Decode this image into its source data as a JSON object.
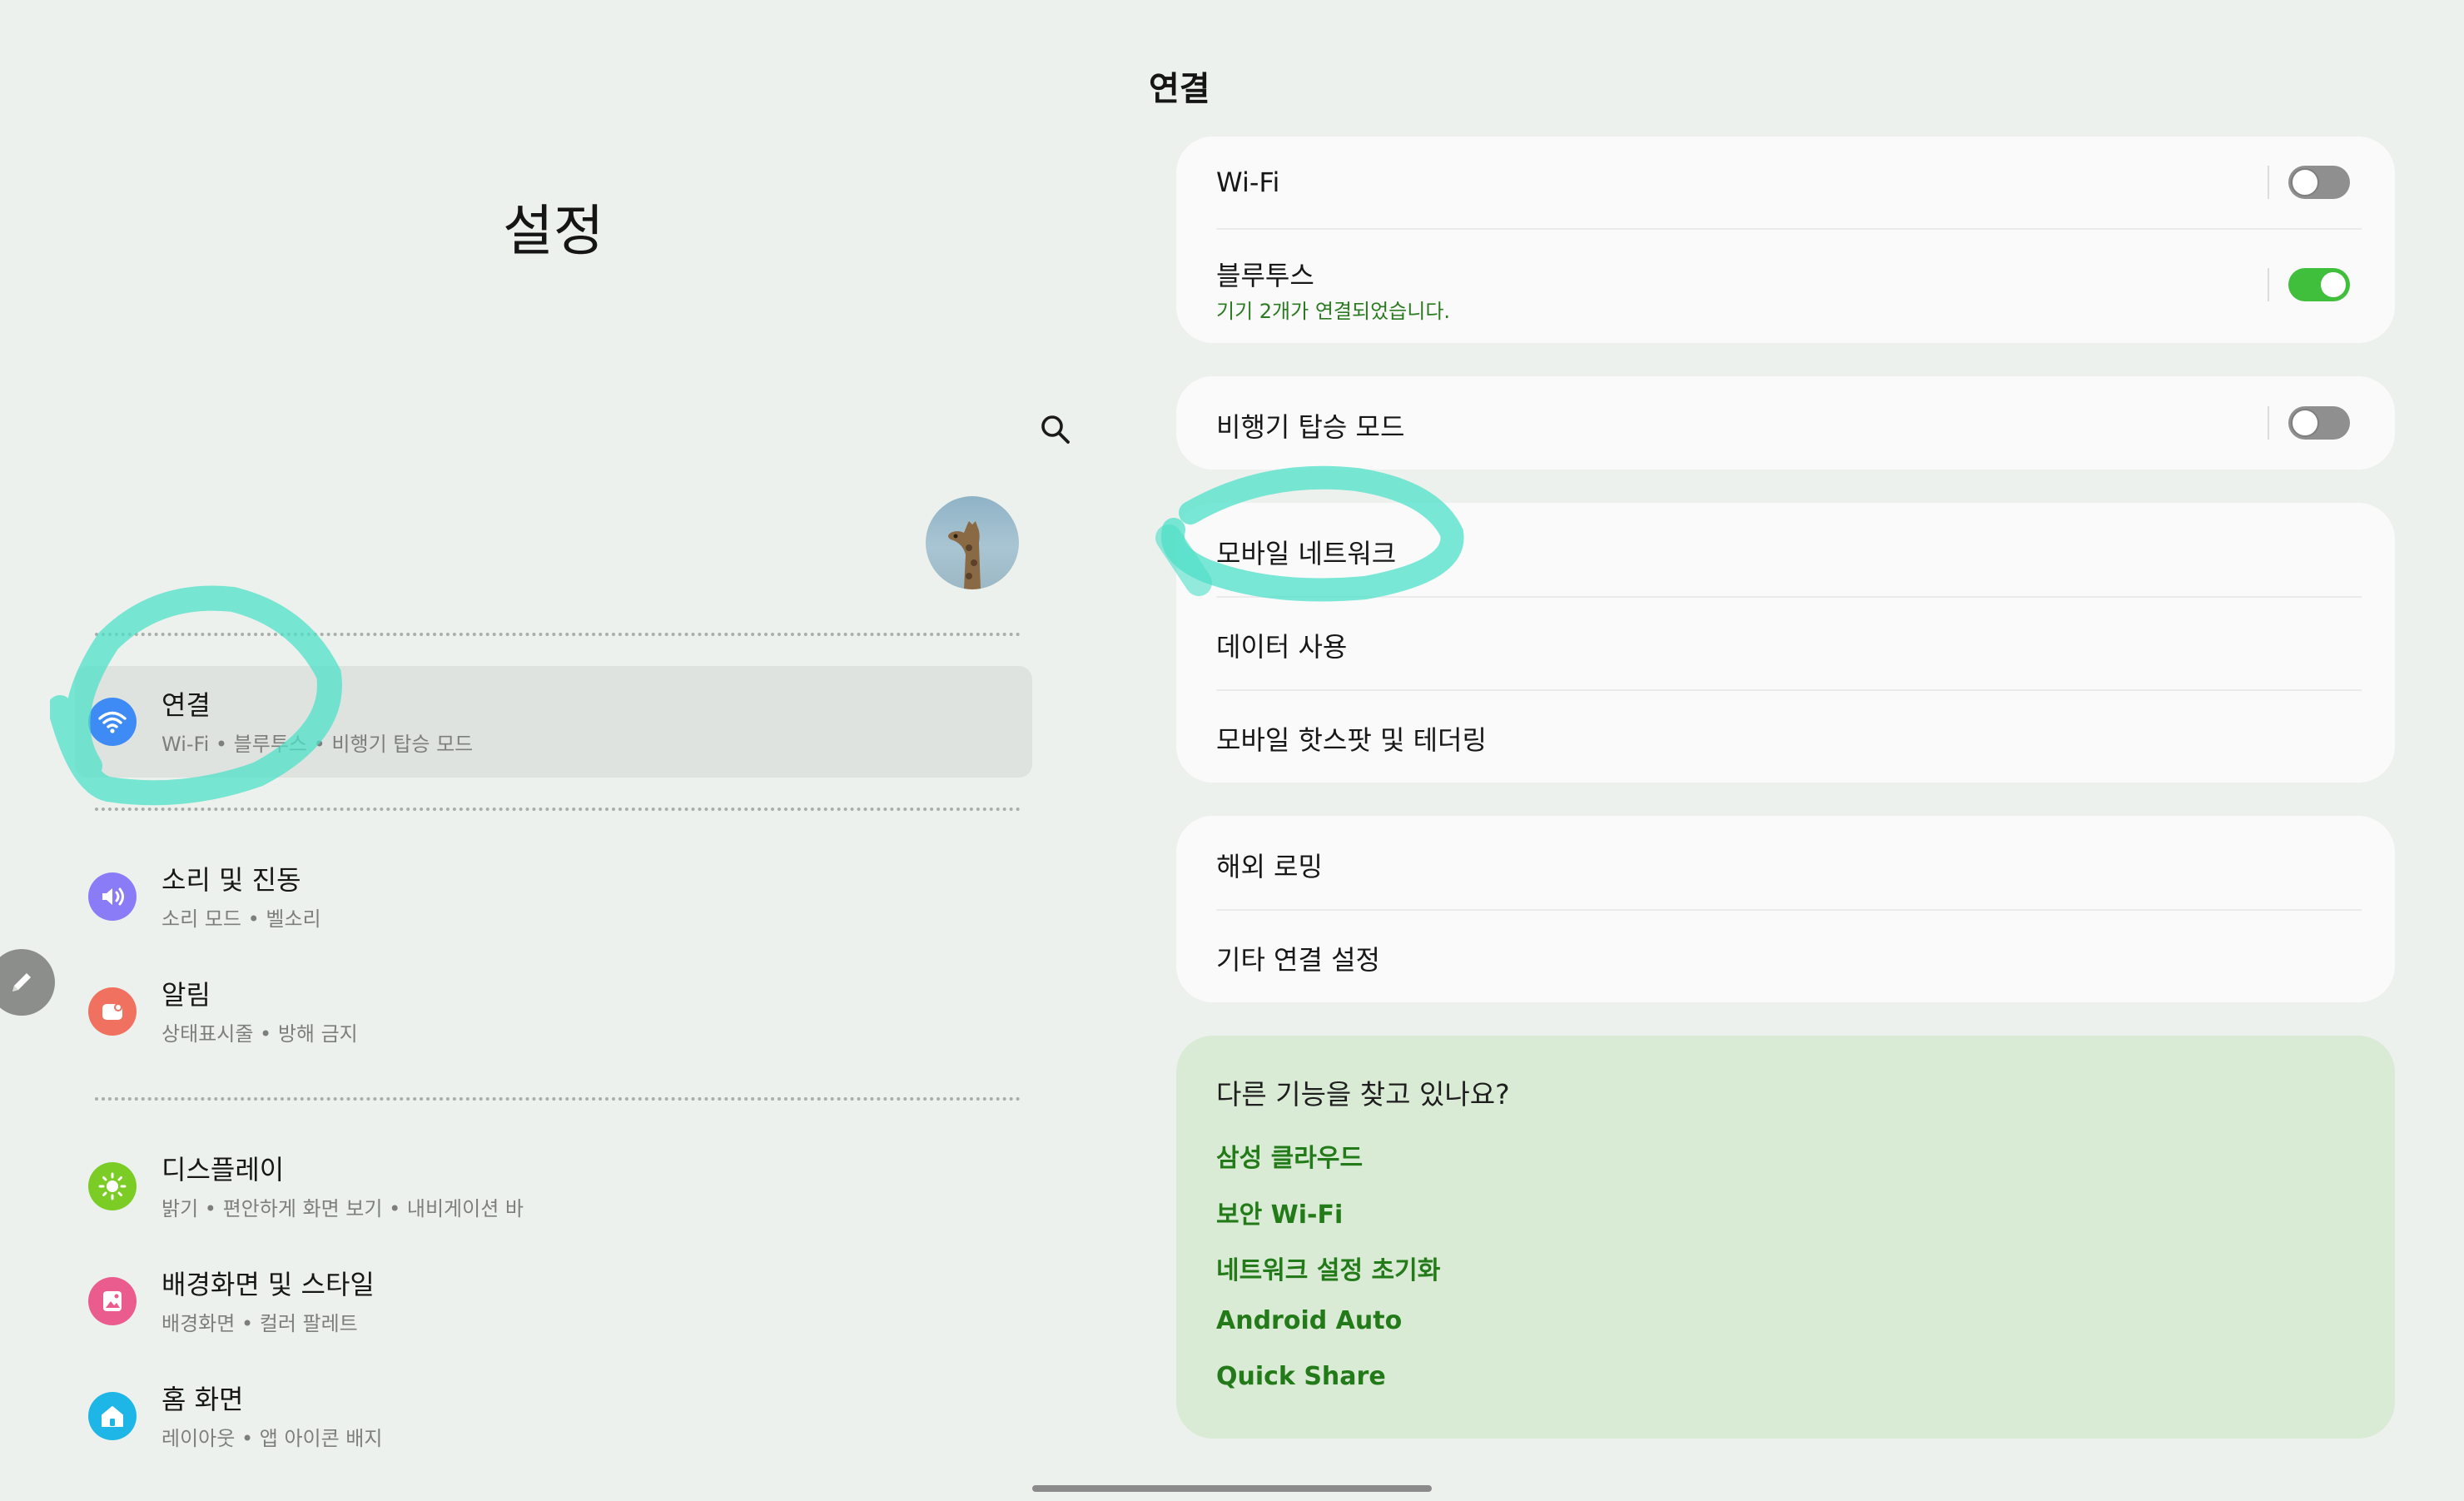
{
  "left_pane": {
    "title": "설정",
    "search_icon": "search-icon",
    "avatar_icon": "giraffe-avatar",
    "menu": [
      {
        "title": "연결",
        "subtitle": "Wi-Fi  •  블루투스  •  비행기 탑승 모드",
        "icon": "wifi-icon",
        "color": "#3e8bf5",
        "selected": true
      },
      {
        "title": "소리 및 진동",
        "subtitle": "소리 모드  •  벨소리",
        "icon": "speaker-icon",
        "color": "#8a7cf6",
        "selected": false
      },
      {
        "title": "알림",
        "subtitle": "상태표시줄  •  방해 금지",
        "icon": "notification-icon",
        "color": "#f0715f",
        "selected": false
      },
      {
        "title": "디스플레이",
        "subtitle": "밝기  •  편안하게 화면 보기  •  내비게이션 바",
        "icon": "sun-icon",
        "color": "#7ccc26",
        "selected": false
      },
      {
        "title": "배경화면 및 스타일",
        "subtitle": "배경화면  •  컬러 팔레트",
        "icon": "wallpaper-icon",
        "color": "#ea5c8e",
        "selected": false
      },
      {
        "title": "홈 화면",
        "subtitle": "레이아웃  •  앱 아이콘 배지",
        "icon": "home-icon",
        "color": "#1eb6e6",
        "selected": false
      }
    ]
  },
  "right_pane": {
    "title": "연결",
    "groups": [
      [
        {
          "title": "Wi-Fi",
          "subtitle": "",
          "toggle": "off"
        },
        {
          "title": "블루투스",
          "subtitle": "기기 2개가 연결되었습니다.",
          "toggle": "on"
        }
      ],
      [
        {
          "title": "비행기 탑승 모드",
          "subtitle": "",
          "toggle": "off"
        }
      ],
      [
        {
          "title": "모바일 네트워크"
        },
        {
          "title": "데이터 사용"
        },
        {
          "title": "모바일 핫스팟 및 테더링"
        }
      ],
      [
        {
          "title": "해외 로밍"
        },
        {
          "title": "기타 연결 설정"
        }
      ]
    ],
    "suggestions": {
      "title": "다른 기능을 찾고 있나요?",
      "links": [
        "삼성 클라우드",
        "보안 Wi-Fi",
        "네트워크 설정 초기화",
        "Android Auto",
        "Quick Share"
      ]
    }
  },
  "colors": {
    "background": "#edf1ed",
    "card": "#fafafa",
    "accent_green": "#237a18",
    "toggle_on": "#3fbf3c",
    "annotation": "#4de0c8"
  }
}
